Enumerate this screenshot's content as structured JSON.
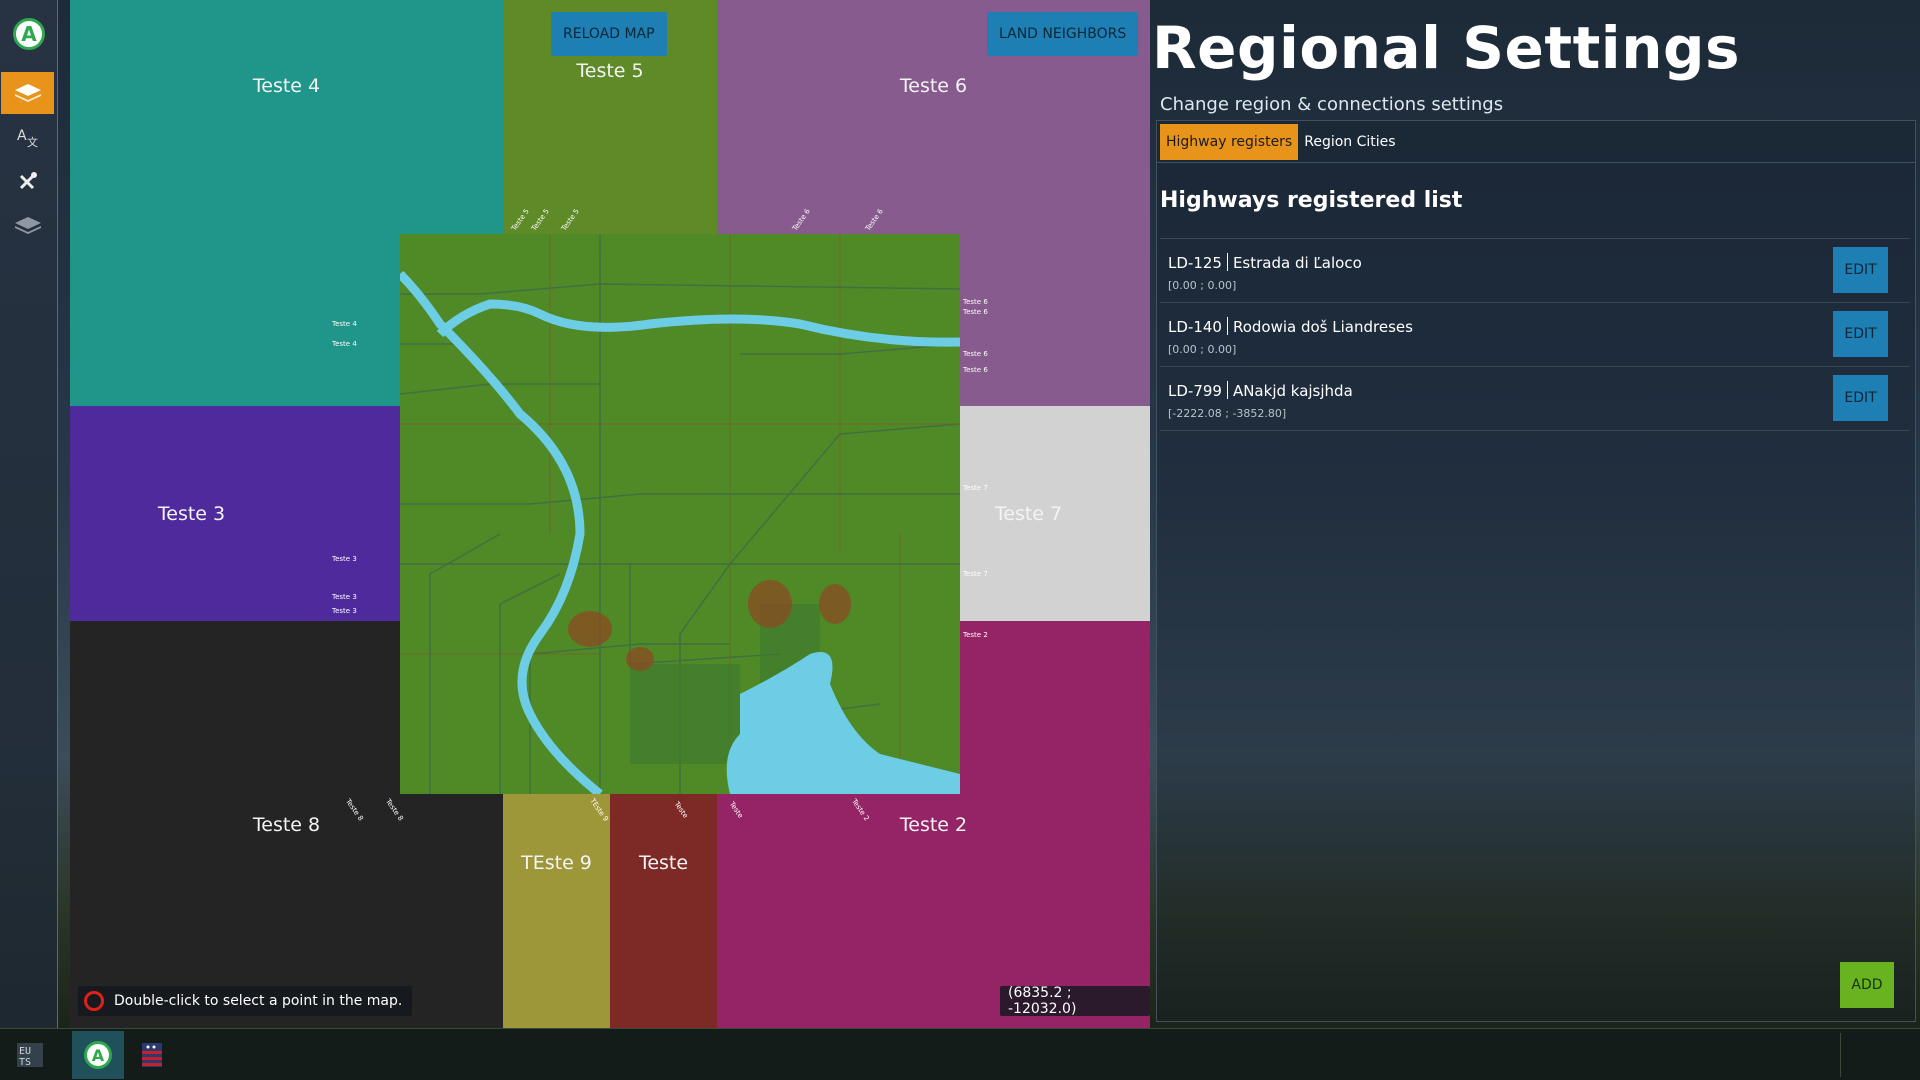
{
  "sidebar": {
    "logo_letter": "A",
    "tools": [
      {
        "icon": "map-layers-icon",
        "active": true
      },
      {
        "icon": "translate-icon",
        "active": false
      },
      {
        "icon": "tools-icon",
        "active": false
      },
      {
        "icon": "layers-stack-icon",
        "active": false
      }
    ]
  },
  "map": {
    "reload_label": "RELOAD MAP",
    "land_neighbors_label": "LAND NEIGHBORS",
    "regions": {
      "teste4": "Teste 4",
      "teste5": "Teste 5",
      "teste6": "Teste 6",
      "teste3": "Teste 3",
      "teste7": "Teste 7",
      "teste8": "Teste 8",
      "teste9": "TEste 9",
      "teste": "Teste",
      "teste2": "Teste 2"
    },
    "connections": {
      "left_a": "Teste 4",
      "left_b": "Teste 4",
      "left_c": "Teste 3",
      "left_d": "Teste 3",
      "left_e": "Teste 3",
      "right_a": "Teste 6",
      "right_b": "Teste 6",
      "right_c": "Teste 6",
      "right_d": "Teste 6",
      "right_e": "Teste 7",
      "right_f": "Teste 7",
      "right_g": "Teste 2",
      "top_a": "Teste 5",
      "top_b": "Teste 5",
      "top_c": "Teste 5",
      "top_d": "Teste 6",
      "top_e": "Teste 6",
      "bottom_a": "Teste 8",
      "bottom_b": "Teste 8",
      "bottom_c": "TEste 9",
      "bottom_d": "Teste",
      "bottom_e": "Teste",
      "bottom_f": "Teste 2"
    },
    "hint": "Double-click to select a point in the map.",
    "coords": "(6835.2 ; -12032.0)"
  },
  "panel": {
    "title": "Regional Settings",
    "subtitle": "Change region & connections settings",
    "tabs": [
      {
        "label": "Highway registers",
        "active": true
      },
      {
        "label": "Region Cities",
        "active": false
      }
    ],
    "list_title": "Highways registered list",
    "highways": [
      {
        "code": "LD-125",
        "name": "Estrada di Ľaloco",
        "position": "[0.00 ; 0.00]",
        "edit": "EDIT"
      },
      {
        "code": "LD-140",
        "name": "Rodowia doš Liandreses",
        "position": "[0.00 ; 0.00]",
        "edit": "EDIT"
      },
      {
        "code": "LD-799",
        "name": "ANakjd kajsjhda",
        "position": "[-2222.08 ; -3852.80]",
        "edit": "EDIT"
      }
    ],
    "add_label": "ADD"
  },
  "taskbar": {
    "items": [
      {
        "icon": "eu-flag-icon",
        "active": false
      },
      {
        "icon": "app-logo-icon",
        "label": "A",
        "active": true
      },
      {
        "icon": "us-flag-icon",
        "active": false
      }
    ]
  },
  "colors": {
    "accent_orange": "#e8941a",
    "button_blue": "#1e7fb5",
    "add_green": "#6ab320",
    "city_green": "#4f8a26",
    "water": "#6ccde4"
  }
}
